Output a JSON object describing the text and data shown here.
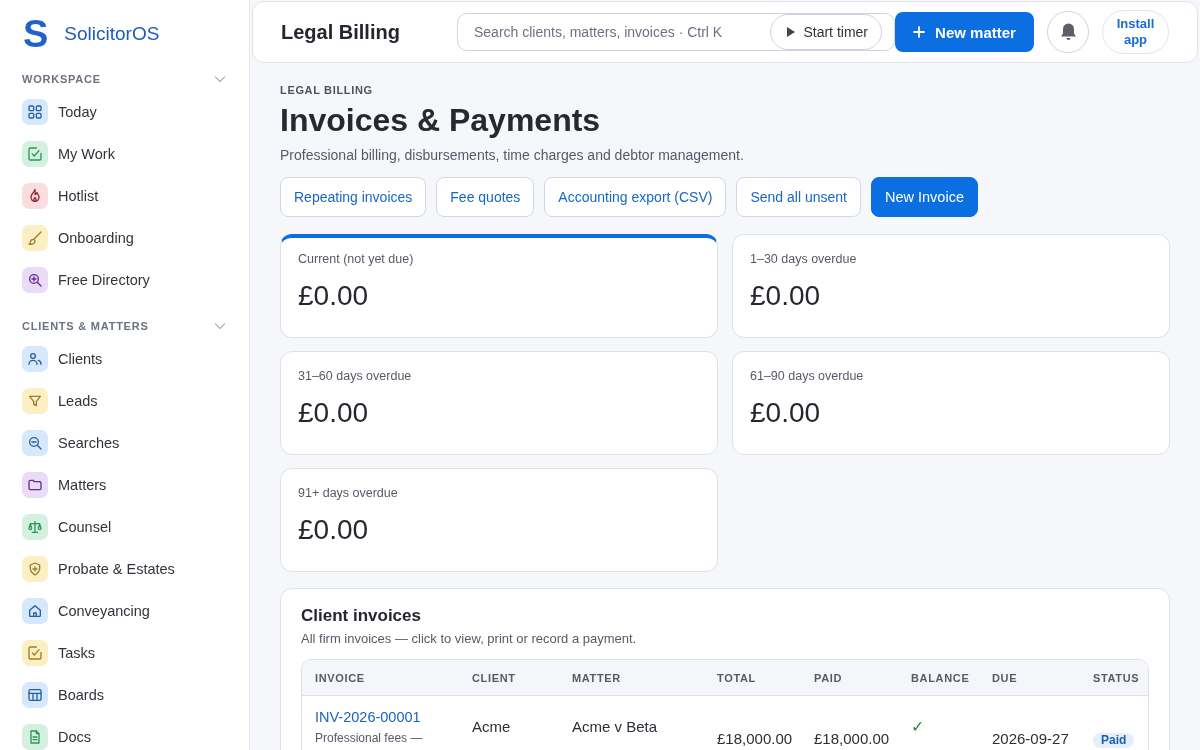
{
  "sidebar": {
    "brand": {
      "mark": "S",
      "name": "SolicitorOS"
    },
    "sections": [
      {
        "title": "WORKSPACE",
        "expanded": true,
        "items": [
          {
            "label": "Today",
            "color": "#d6e8fb"
          },
          {
            "label": "My Work",
            "color": "#d5f0e0"
          },
          {
            "label": "Hotlist",
            "color": "#fbdde0"
          },
          {
            "label": "Onboarding",
            "color": "#fcefc4"
          },
          {
            "label": "Free Directory",
            "color": "#eadcf6"
          }
        ]
      },
      {
        "title": "CLIENTS & MATTERS",
        "expanded": true,
        "items": [
          {
            "label": "Clients",
            "color": "#d6e8fb"
          },
          {
            "label": "Leads",
            "color": "#fcefc4"
          },
          {
            "label": "Searches",
            "color": "#d6e8fb"
          },
          {
            "label": "Matters",
            "color": "#eadcf6"
          },
          {
            "label": "Counsel",
            "color": "#d5f0e0"
          },
          {
            "label": "Probate & Estates",
            "color": "#fcefc4"
          },
          {
            "label": "Conveyancing",
            "color": "#d6e8fb"
          },
          {
            "label": "Tasks",
            "color": "#fcefc4"
          },
          {
            "label": "Boards",
            "color": "#d6e8fb"
          },
          {
            "label": "Docs",
            "color": "#d5f0e0"
          }
        ]
      }
    ]
  },
  "header": {
    "title": "Legal Billing",
    "search": {
      "placeholder": "Search clients, matters, invoices · Ctrl K"
    },
    "timer_button": "Start timer",
    "new_button": "New matter",
    "install_button": "Install app"
  },
  "page": {
    "eyebrow": "LEGAL BILLING",
    "title": "Invoices & Payments",
    "subtitle": "Professional billing, disbursements, time charges and debtor management.",
    "actions": [
      {
        "label": "Repeating invoices",
        "kind": "outline"
      },
      {
        "label": "Fee quotes",
        "kind": "outline"
      },
      {
        "label": "Accounting export (CSV)",
        "kind": "outline"
      },
      {
        "label": "Send all unsent",
        "kind": "outline"
      },
      {
        "label": "New Invoice",
        "kind": "primary"
      }
    ]
  },
  "aging_cards": [
    {
      "label": "Current (not yet due)",
      "value": "£0.00",
      "selected": true
    },
    {
      "label": "1–30 days overdue",
      "value": "£0.00",
      "selected": false
    },
    {
      "label": "31–60 days overdue",
      "value": "£0.00",
      "selected": false
    },
    {
      "label": "61–90 days overdue",
      "value": "£0.00",
      "selected": false
    },
    {
      "label": "91+ days overdue",
      "value": "£0.00",
      "selected": false
    }
  ],
  "invoices": {
    "title": "Client invoices",
    "subtitle": "All firm invoices — click to view, print or record a payment.",
    "table": {
      "columns": [
        "INVOICE",
        "CLIENT",
        "MATTER",
        "TOTAL",
        "PAID",
        "BALANCE",
        "DUE",
        "STATUS"
      ],
      "rows": [
        {
          "invoice": "INV-2026-00001",
          "description": "Professional fees —",
          "client": "Acme",
          "matter": "Acme v Beta",
          "total": "£18,000.00",
          "paid": "£18,000.00",
          "balance": "✓",
          "due": "2026-09-27",
          "status": "Paid"
        }
      ]
    }
  }
}
